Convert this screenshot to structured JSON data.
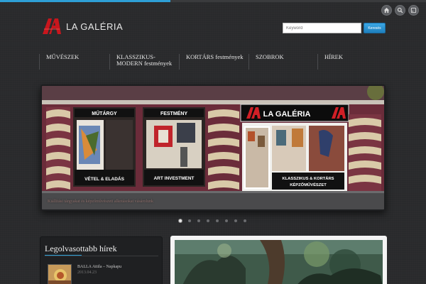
{
  "site": {
    "logo_text": "LA GALÉRIA"
  },
  "top_icons": [
    "home-icon",
    "search-icon",
    "rss-icon"
  ],
  "search": {
    "placeholder": "Keyword",
    "button_label": "Keresés"
  },
  "nav": {
    "items": [
      {
        "label": "MŰVÉSZEK"
      },
      {
        "label": "KLASSZIKUS-\nMODERN festmények"
      },
      {
        "label": "KORTÁRS festmények"
      },
      {
        "label": "SZOBROK"
      },
      {
        "label": "HÍREK"
      }
    ]
  },
  "slider": {
    "signs": {
      "mutargy": "MŰTÁRGY",
      "festmeny": "FESTMÉNY",
      "gallery": "LA GALÉRIA",
      "vetel": "VÉTEL & ELADÁS",
      "art_investment": "ART INVESTMENT",
      "klasszikus_line1": "KLASSZIKUS & KORTÁRS",
      "klasszikus_line2": "KÉPZŐMŰVÉSZET"
    },
    "caption": "Kiállítási tárgyakat és képzőművészeti alkotásokat vásárolunk",
    "dot_count": 8,
    "active_dot": 0
  },
  "news_panel": {
    "title": "Legolvasottabb hírek",
    "items": [
      {
        "title": "BALLA Attila – Napkapu",
        "date": "2013.04.23"
      }
    ]
  },
  "colors": {
    "accent": "#2e9fd6",
    "logo_red": "#c8161d",
    "background": "#2a2b2d"
  }
}
